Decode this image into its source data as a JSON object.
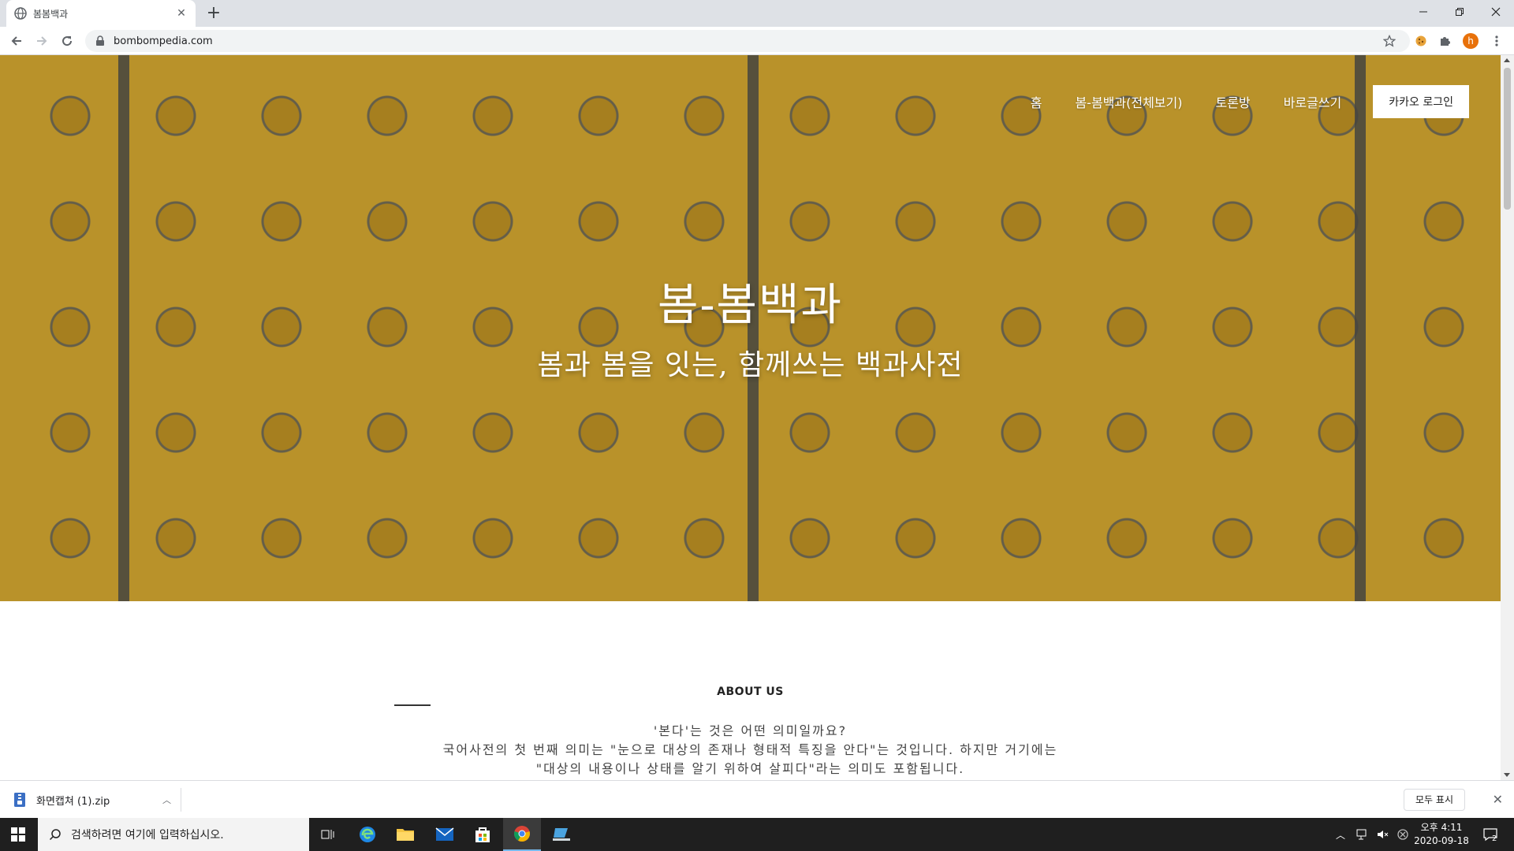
{
  "browser": {
    "tab_title": "봄봄백과",
    "url": "bombompedia.com",
    "profile_initial": "h"
  },
  "site": {
    "nav": {
      "home": "홈",
      "all_entries": "봄-봄백과(전체보기)",
      "discussion": "토론방",
      "correct_writing": "바로글쓰기",
      "login": "카카오 로그인"
    },
    "hero_title": "봄-봄백과",
    "hero_subtitle": "봄과 봄을 잇는, 함께쓰는 백과사전",
    "about": {
      "heading": "ABOUT US",
      "line1": "'본다'는 것은 어떤 의미일까요?",
      "line2": "국어사전의 첫 번째 의미는 \"눈으로 대상의 존재나 형태적 특징을 안다\"는 것입니다. 하지만 거기에는",
      "line3": "\"대상의 내용이나 상태를 알기 위하여 살피다\"라는 의미도 포함됩니다."
    }
  },
  "downloads": {
    "file_name": "화면캡쳐 (1).zip",
    "show_all": "모두 표시"
  },
  "taskbar": {
    "search_placeholder": "검색하려면 여기에 입력하십시오.",
    "time": "오후 4:11",
    "date": "2020-09-18",
    "notification_count": "2"
  },
  "colors": {
    "hero_base": "#c99f2e",
    "chrome_tabstrip": "#dee1e6",
    "taskbar": "#1f1f1f",
    "profile": "#e8710a"
  }
}
